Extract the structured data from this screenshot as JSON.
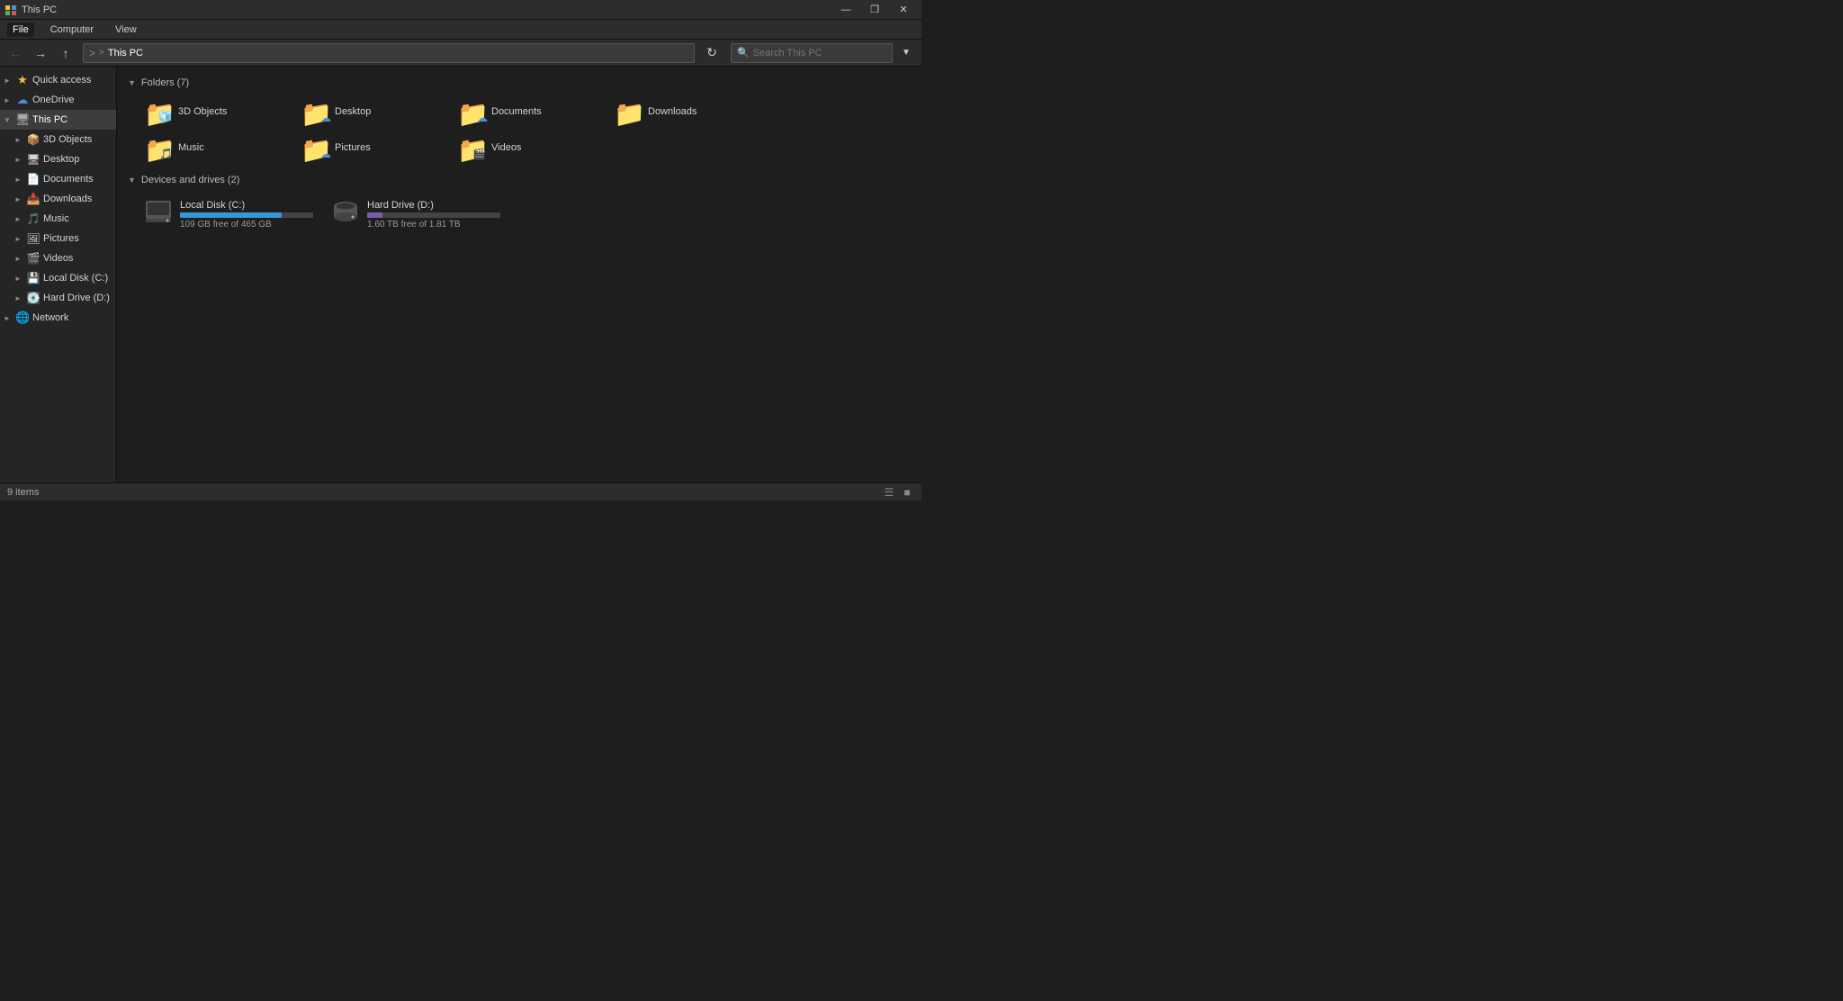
{
  "titleBar": {
    "title": "This PC",
    "controls": [
      "—",
      "❐",
      "✕"
    ]
  },
  "ribbon": {
    "tabs": [
      "File",
      "Computer",
      "View"
    ]
  },
  "toolbar": {
    "back": "←",
    "forward": "→",
    "up": "↑",
    "path": [
      "This PC"
    ],
    "searchPlaceholder": "Search This PC"
  },
  "sidebar": {
    "items": [
      {
        "id": "quick-access",
        "label": "Quick access",
        "level": 1,
        "expanded": false,
        "icon": "⭐"
      },
      {
        "id": "onedrive",
        "label": "OneDrive",
        "level": 1,
        "expanded": false,
        "icon": "☁"
      },
      {
        "id": "this-pc",
        "label": "This PC",
        "level": 1,
        "expanded": true,
        "icon": "💻",
        "selected": true
      },
      {
        "id": "3d-objects",
        "label": "3D Objects",
        "level": 2,
        "icon": "📦"
      },
      {
        "id": "desktop",
        "label": "Desktop",
        "level": 2,
        "icon": "🖥"
      },
      {
        "id": "documents",
        "label": "Documents",
        "level": 2,
        "icon": "📄"
      },
      {
        "id": "downloads",
        "label": "Downloads",
        "level": 2,
        "icon": "📥"
      },
      {
        "id": "music",
        "label": "Music",
        "level": 2,
        "icon": "🎵"
      },
      {
        "id": "pictures",
        "label": "Pictures",
        "level": 2,
        "icon": "🖼"
      },
      {
        "id": "videos",
        "label": "Videos",
        "level": 2,
        "icon": "🎬"
      },
      {
        "id": "local-disk-c",
        "label": "Local Disk (C:)",
        "level": 2,
        "icon": "💾"
      },
      {
        "id": "hard-drive-d",
        "label": "Hard Drive (D:)",
        "level": 2,
        "icon": "💽"
      },
      {
        "id": "network",
        "label": "Network",
        "level": 1,
        "expanded": false,
        "icon": "🌐"
      }
    ]
  },
  "content": {
    "foldersSection": {
      "title": "Folders (7)",
      "folders": [
        {
          "name": "3D Objects",
          "icon": "folder",
          "badge": "3d"
        },
        {
          "name": "Desktop",
          "icon": "folder",
          "badge": "onedrive"
        },
        {
          "name": "Documents",
          "icon": "folder",
          "badge": "onedrive"
        },
        {
          "name": "Downloads",
          "icon": "folder",
          "badge": ""
        },
        {
          "name": "Music",
          "icon": "folder",
          "badge": ""
        },
        {
          "name": "Pictures",
          "icon": "folder",
          "badge": "onedrive"
        },
        {
          "name": "Videos",
          "icon": "folder",
          "badge": ""
        }
      ]
    },
    "drivesSection": {
      "title": "Devices and drives (2)",
      "drives": [
        {
          "name": "Local Disk (C:)",
          "icon": "🖥",
          "usedPercent": 76.5,
          "freeText": "109 GB free of 465 GB",
          "barColor": "blue"
        },
        {
          "name": "Hard Drive (D:)",
          "icon": "💽",
          "usedPercent": 11.6,
          "freeText": "1.60 TB free of 1.81 TB",
          "barColor": "purple"
        }
      ]
    }
  },
  "statusBar": {
    "itemCount": "9 items"
  }
}
